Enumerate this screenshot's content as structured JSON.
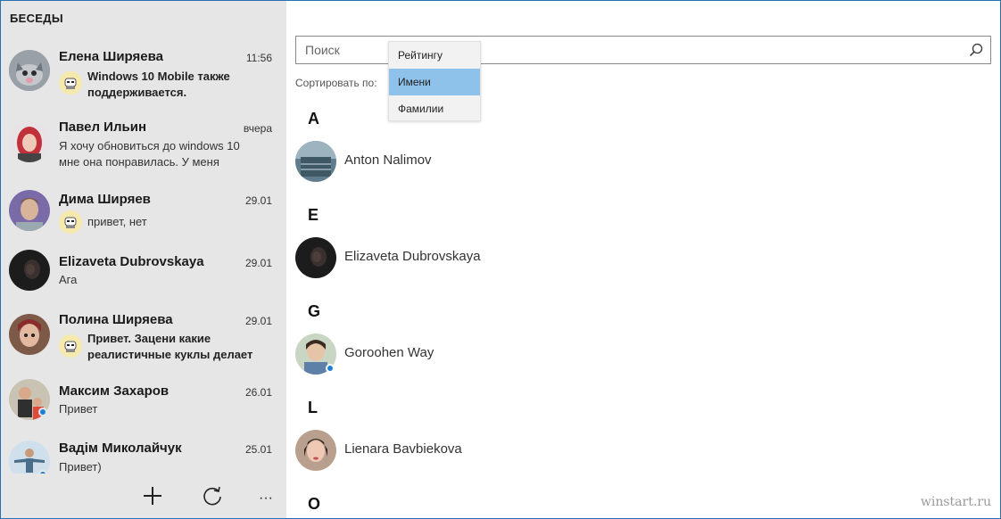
{
  "left": {
    "title": "БЕСЕДЫ",
    "conversations": [
      {
        "name": "Елена Ширяева",
        "time": "11:56",
        "message": "Windows 10 Mobile также поддерживается.",
        "sticker": true,
        "bold": true,
        "online": false
      },
      {
        "name": "Павел Ильин",
        "time": "вчера",
        "message": "Я хочу обновиться до windows 10 мне она понравилась. У меня",
        "sticker": false,
        "bold": false,
        "online": false
      },
      {
        "name": "Дима Ширяев",
        "time": "29.01",
        "message": "привет, нет",
        "sticker": true,
        "bold": false,
        "online": false
      },
      {
        "name": "Elizaveta Dubrovskaya",
        "time": "29.01",
        "message": "Ага",
        "sticker": false,
        "bold": false,
        "online": false
      },
      {
        "name": "Полина Ширяева",
        "time": "29.01",
        "message": "Привет. Зацени какие реалистичные куклы делает",
        "sticker": true,
        "bold": true,
        "online": false
      },
      {
        "name": "Максим Захаров",
        "time": "26.01",
        "message": "Привет",
        "sticker": false,
        "bold": false,
        "online": true
      },
      {
        "name": "Вадім Миколайчук",
        "time": "25.01",
        "message": "Привет)",
        "sticker": false,
        "bold": false,
        "online": true
      }
    ],
    "bottom_bar": {
      "add_icon": "plus-icon",
      "refresh_icon": "refresh-icon",
      "more_label": "···"
    }
  },
  "right": {
    "search": {
      "placeholder": "Поиск",
      "icon": "search-icon"
    },
    "sort_label": "Сортировать по:",
    "sort_options": [
      {
        "label": "Рейтингу",
        "selected": false
      },
      {
        "label": "Имени",
        "selected": true
      },
      {
        "label": "Фамилии",
        "selected": false
      }
    ],
    "groups": [
      {
        "letter": "A",
        "contacts": [
          {
            "name": "Anton Nalimov",
            "online": false
          }
        ]
      },
      {
        "letter": "E",
        "contacts": [
          {
            "name": "Elizaveta Dubrovskaya",
            "online": false
          }
        ]
      },
      {
        "letter": "G",
        "contacts": [
          {
            "name": "Goroohen Way",
            "online": true
          }
        ]
      },
      {
        "letter": "L",
        "contacts": [
          {
            "name": "Lienara Bavbiekova",
            "online": false
          }
        ]
      },
      {
        "letter": "O",
        "contacts": []
      }
    ]
  },
  "watermark": "winstart.ru",
  "colors": {
    "accent": "#1e7fd6",
    "selection": "#8ec2eb",
    "left_bg": "#e6e6e6"
  }
}
